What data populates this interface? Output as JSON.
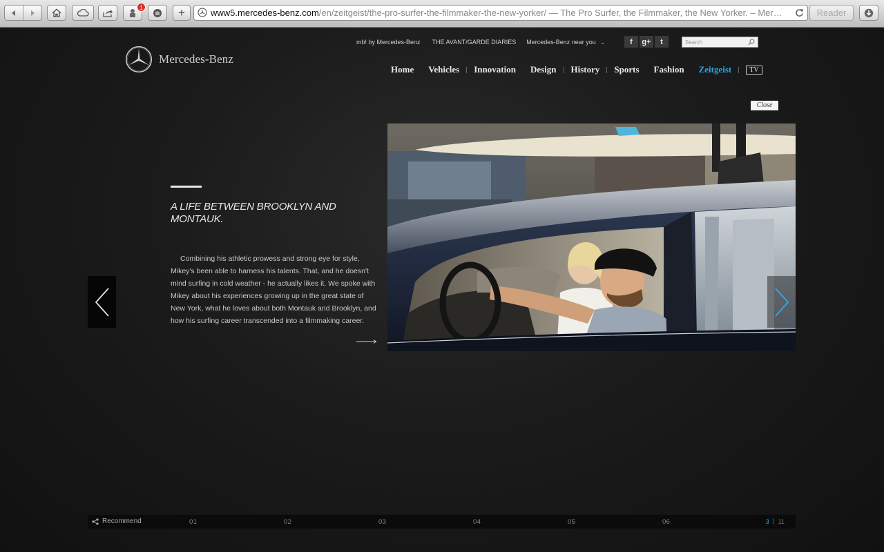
{
  "browser": {
    "url_domain": "www5.mercedes-benz.com",
    "url_path": "/en/zeitgeist/the-pro-surfer-the-filmmaker-the-new-yorker/",
    "page_title": " — The Pro Surfer, the Filmmaker, the New Yorker. – Mer…",
    "reader_label": "Reader",
    "badge_count": "1",
    "new_tab_label": "+"
  },
  "brand": {
    "name": "Mercedes-Benz"
  },
  "utility_nav": {
    "mb": "mb! by Mercedes-Benz",
    "avantgarde": "THE AVANT/GARDE DIARIES",
    "near_you": "Mercedes-Benz near you",
    "chevron": "⌄"
  },
  "social": {
    "facebook": "f",
    "googleplus": "g+",
    "twitter": "t"
  },
  "search": {
    "placeholder": "Search"
  },
  "main_nav": {
    "items": [
      "Home",
      "Vehicles",
      "Innovation",
      "Design",
      "History",
      "Sports",
      "Fashion",
      "Zeitgeist"
    ],
    "active": "Zeitgeist",
    "tv": "TV"
  },
  "close_label": "Close",
  "article": {
    "headline": "A LIFE BETWEEN BROOKLYN AND MONTAUK.",
    "body": "Combining his athletic prowess and strong eye for style, Mikey's been able to harness his talents. That, and he doesn't mind surfing in cold weather - he actually likes it. We spoke with Mikey about his experiences growing up in the great state of New York, what he loves about both Montauk and Brooklyn, and how his surfing career transcended into a filmmaking career."
  },
  "footer": {
    "recommend": "Recommend",
    "pages": [
      "01",
      "02",
      "03",
      "04",
      "05",
      "06"
    ],
    "current_page": "03",
    "counter_current": "3",
    "counter_total": "11"
  },
  "colors": {
    "accent": "#2ea6e0",
    "background": "#1b1b1b"
  }
}
